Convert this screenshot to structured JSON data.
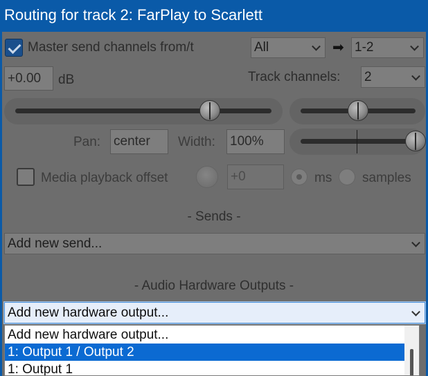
{
  "window": {
    "title": "Routing for track 2: FarPlay to Scarlett"
  },
  "master_send": {
    "checked": true,
    "label": "Master send channels from/t",
    "from_value": "All",
    "arrow": "➡",
    "to_value": "1-2"
  },
  "volume": {
    "value": "+0.00",
    "unit": "dB"
  },
  "track_channels": {
    "label": "Track channels:",
    "value": "2"
  },
  "sliders": {
    "volume_level": 0.76,
    "pan_level": 0.5,
    "width_level": 1.0
  },
  "pan": {
    "label": "Pan:",
    "value": "center"
  },
  "width": {
    "label": "Width:",
    "value": "100%"
  },
  "media_offset": {
    "checked": false,
    "label": "Media playback offset",
    "value": "+0",
    "unit_ms": "ms",
    "unit_samples": "samples",
    "selected_unit": "ms"
  },
  "sends": {
    "title": "-  Sends  -",
    "dropdown": "Add new send..."
  },
  "hw_outputs": {
    "title": "-  Audio Hardware Outputs  -",
    "dropdown": "Add new hardware output...",
    "options": [
      "Add new hardware output...",
      "1: Output 1 / Output 2",
      "1: Output 1"
    ],
    "highlighted_index": 1
  },
  "colors": {
    "title_bar": "#0a5aa8",
    "highlight": "#0b6ad2",
    "dimmed_bg": "#6d6d6d"
  }
}
